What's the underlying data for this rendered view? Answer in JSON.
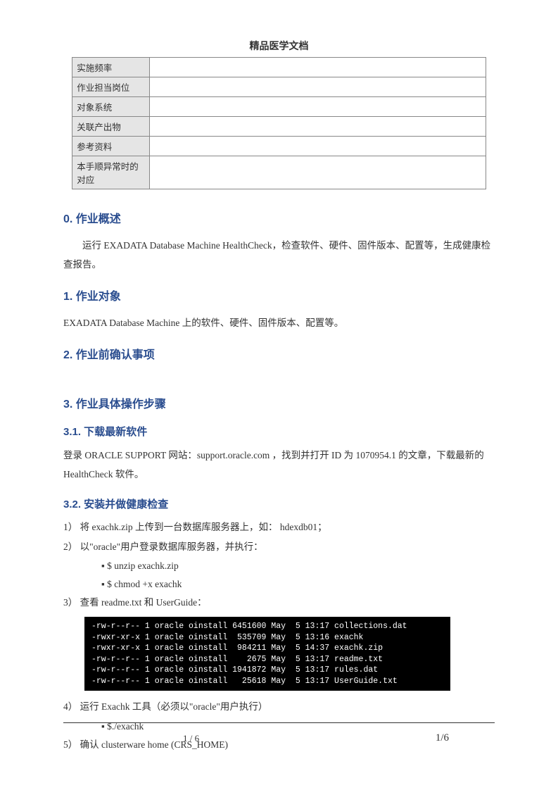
{
  "header": {
    "title": "精品医学文档"
  },
  "table": {
    "rows": [
      {
        "label": "实施频率",
        "value": ""
      },
      {
        "label": "作业担当岗位",
        "value": ""
      },
      {
        "label": "对象系统",
        "value": ""
      },
      {
        "label": "关联产出物",
        "value": ""
      },
      {
        "label": "参考资料",
        "value": ""
      },
      {
        "label": "本手顺异常时的对应",
        "value": ""
      }
    ]
  },
  "sections": {
    "s0": {
      "title": "0.  作业概述",
      "text": "运行 EXADATA Database Machine HealthCheck，检查软件、硬件、固件版本、配置等，生成健康检查报告。"
    },
    "s1": {
      "title": "1.  作业对象",
      "text": "EXADATA Database Machine 上的软件、硬件、固件版本、配置等。"
    },
    "s2": {
      "title": "2.  作业前确认事项"
    },
    "s3": {
      "title": "3.  作业具体操作步骤"
    },
    "s31": {
      "title": "3.1.  下载最新软件",
      "text": "登录 ORACLE SUPPORT 网站：support.oracle.com  ，找到并打开 ID 为 1070954.1 的文章，下载最新的 HealthCheck 软件。"
    },
    "s32": {
      "title": "3.2.  安装并做健康检查",
      "step1": "1） 将 exachk.zip 上传到一台数据库服务器上，如：  hdexdb01；",
      "step2": "2） 以\"oracle\"用户登录数据库服务器，并执行：",
      "cmd1": "$ unzip exachk.zip",
      "cmd2": "$ chmod +x exachk",
      "step3": "3） 查看 readme.txt  和  UserGuide：",
      "terminal": "-rw-r--r-- 1 oracle oinstall 6451600 May  5 13:17 collections.dat\n-rwxr-xr-x 1 oracle oinstall  535709 May  5 13:16 exachk\n-rwxr-xr-x 1 oracle oinstall  984211 May  5 14:37 exachk.zip\n-rw-r--r-- 1 oracle oinstall    2675 May  5 13:17 readme.txt\n-rw-r--r-- 1 oracle oinstall 1941872 May  5 13:17 rules.dat\n-rw-r--r-- 1 oracle oinstall   25618 May  5 13:17 UserGuide.txt",
      "step4": "4） 运行 Exachk 工具（必须以\"oracle\"用户执行）",
      "cmd3": "$./exachk",
      "step5": "5） 确认 clusterware home (CRS_HOME)"
    }
  },
  "footer": {
    "left": "1 / 6",
    "right": "1/6"
  }
}
